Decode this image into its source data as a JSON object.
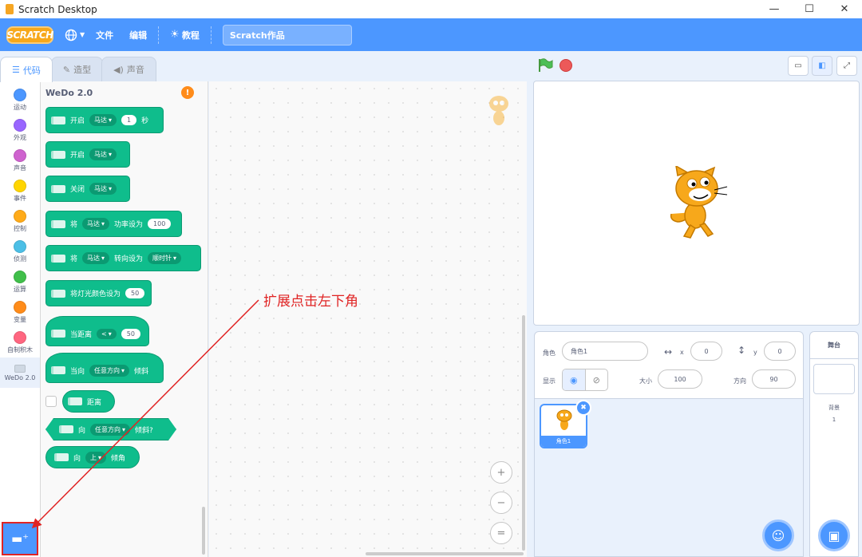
{
  "window": {
    "title": "Scratch Desktop",
    "controls": [
      "—",
      "☐",
      "✕"
    ]
  },
  "menubar": {
    "logo": "SCRATCH",
    "language_icon": "globe-icon",
    "file": "文件",
    "edit": "编辑",
    "tutorials": "教程",
    "project_title": "Scratch作品"
  },
  "tabs": {
    "code": "代码",
    "costumes": "造型",
    "sounds": "声音"
  },
  "categories": [
    {
      "label": "运动",
      "color": "#4c97ff"
    },
    {
      "label": "外观",
      "color": "#9966ff"
    },
    {
      "label": "声音",
      "color": "#cf63cf"
    },
    {
      "label": "事件",
      "color": "#ffd500"
    },
    {
      "label": "控制",
      "color": "#ffab19"
    },
    {
      "label": "侦测",
      "color": "#4cbfe6"
    },
    {
      "label": "运算",
      "color": "#40bf4a"
    },
    {
      "label": "变量",
      "color": "#ff8c1a"
    },
    {
      "label": "自制积木",
      "color": "#ff6680"
    },
    {
      "label": "WeDo 2.0",
      "color": "#cfd8e3"
    }
  ],
  "palette": {
    "title": "WeDo 2.0",
    "blocks": {
      "b1": {
        "t1": "开启",
        "menu": "马达",
        "value": "1",
        "t2": "秒"
      },
      "b2": {
        "t1": "开启",
        "menu": "马达"
      },
      "b3": {
        "t1": "关闭",
        "menu": "马达"
      },
      "b4": {
        "t1": "将",
        "menu": "马达",
        "t2": "功率设为",
        "value": "100"
      },
      "b5": {
        "t1": "将",
        "menu": "马达",
        "t2": "转向设为",
        "menu2": "顺时针"
      },
      "b6": {
        "t1": "将灯光颜色设为",
        "value": "50"
      },
      "b7": {
        "t1": "当距离",
        "menu": "<",
        "value": "50"
      },
      "b8": {
        "t1": "当向",
        "menu": "任意方向",
        "t2": "倾斜"
      },
      "b9": {
        "t1": "距离"
      },
      "b10": {
        "t1": "向",
        "menu": "任意方向",
        "t2": "倾斜?"
      },
      "b11": {
        "t1": "向",
        "menu": "上",
        "t2": "倾角"
      }
    }
  },
  "annotation": "扩展点击左下角",
  "zoom": {
    "in": "+",
    "out": "−",
    "reset": "="
  },
  "sprite_info": {
    "sprite_label": "角色",
    "sprite_name": "角色1",
    "x_label": "x",
    "x_value": "0",
    "y_label": "y",
    "y_value": "0",
    "show_label": "显示",
    "size_label": "大小",
    "size_value": "100",
    "direction_label": "方向",
    "direction_value": "90"
  },
  "sprites": [
    {
      "name": "角色1"
    }
  ],
  "stage_panel": {
    "title": "舞台",
    "backdrops_label": "背景",
    "backdrops_count": "1"
  }
}
